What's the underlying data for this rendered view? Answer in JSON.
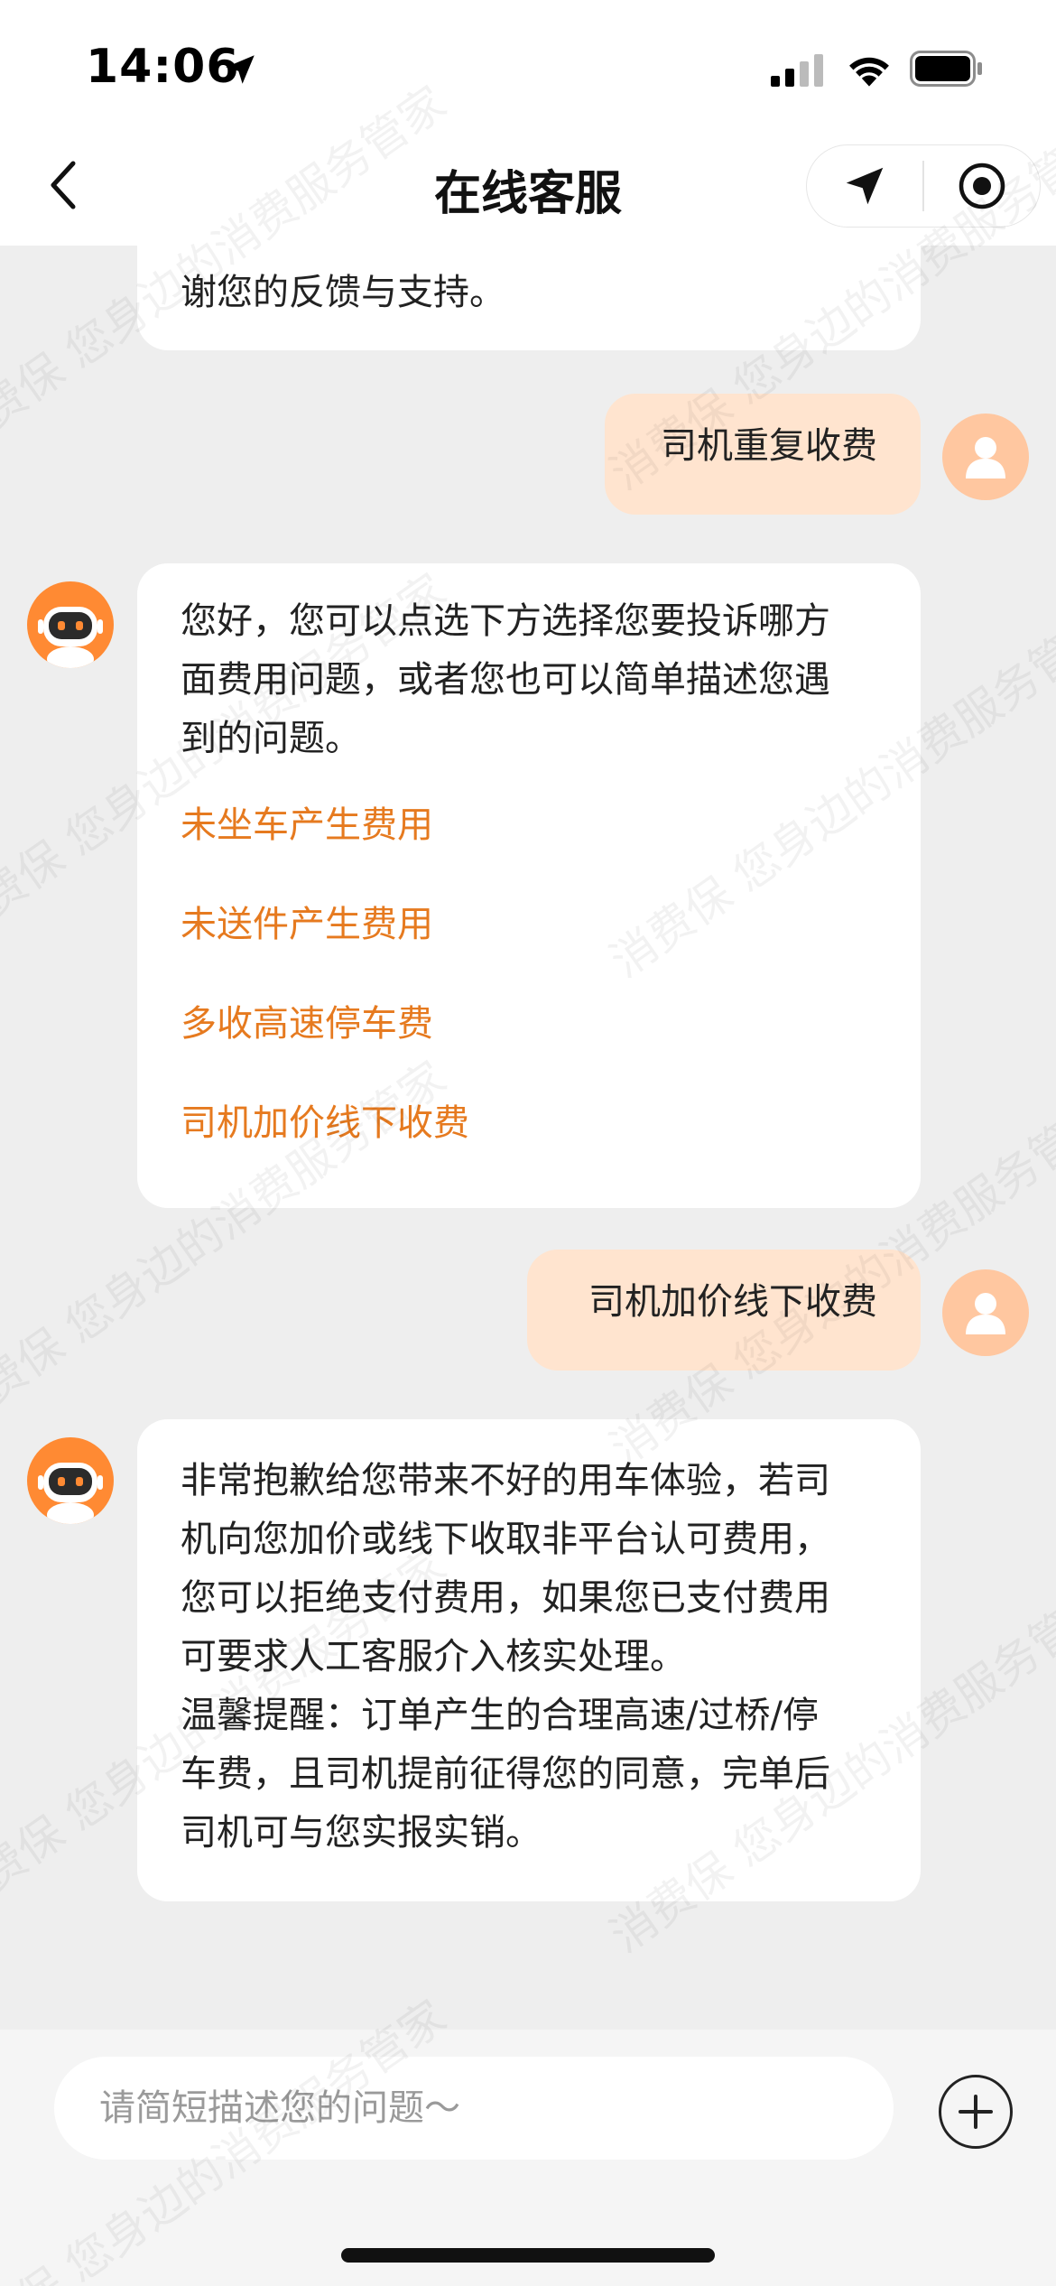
{
  "status_bar": {
    "time": "14:06"
  },
  "nav": {
    "title": "在线客服"
  },
  "chat": {
    "bot_partial": {
      "text": "谢您的反馈与支持。"
    },
    "user_msg_1": {
      "text": "司机重复收费"
    },
    "bot_msg_2": {
      "text": "您好，您可以点选下方选择您要投诉哪方\n面费用问题，或者您也可以简单描述您遇\n到的问题。",
      "options": [
        "未坐车产生费用",
        "未送件产生费用",
        "多收高速停车费",
        "司机加价线下收费"
      ]
    },
    "user_msg_2": {
      "text": "司机加价线下收费"
    },
    "bot_msg_3": {
      "text": "非常抱歉给您带来不好的用车体验，若司\n机向您加价或线下收取非平台认可费用，\n您可以拒绝支付费用，如果您已支付费用\n可要求人工客服介入核实处理。\n温馨提醒：订单产生的合理高速/过桥/停\n车费，且司机提前征得您的同意，完单后\n司机可与您实报实销。"
    }
  },
  "watermark": {
    "text": "消费保 您身边的消费服务管家"
  },
  "input": {
    "placeholder": "请简短描述您的问题～"
  },
  "colors": {
    "accent": "#e67a1f",
    "user_bubble": "#ffe4cf",
    "bot_avatar": "#ff8a33",
    "user_avatar": "#ffc7a0"
  }
}
